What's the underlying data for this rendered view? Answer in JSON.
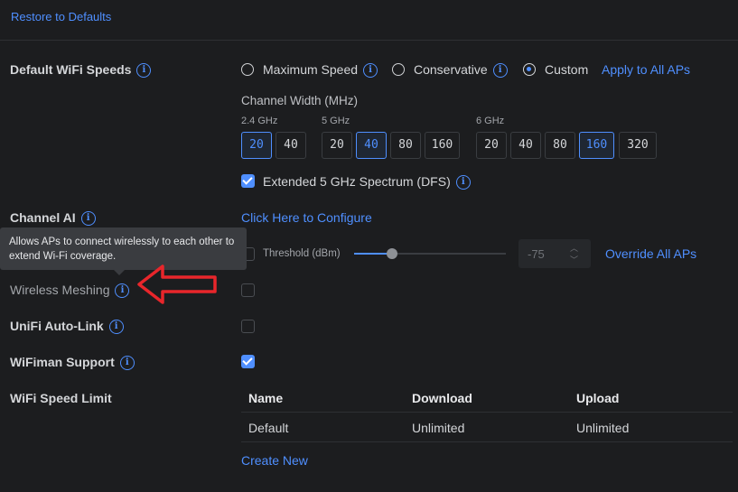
{
  "restore_label": "Restore to Defaults",
  "wifi_speeds": {
    "label": "Default WiFi Speeds",
    "options": [
      "Maximum Speed",
      "Conservative",
      "Custom"
    ],
    "selected": "Custom",
    "apply_label": "Apply to All APs",
    "channel_width_label": "Channel Width (MHz)",
    "bands": [
      {
        "name": "2.4 GHz",
        "widths": [
          "20",
          "40"
        ],
        "selected": "20"
      },
      {
        "name": "5 GHz",
        "widths": [
          "20",
          "40",
          "80",
          "160"
        ],
        "selected": "40"
      },
      {
        "name": "6 GHz",
        "widths": [
          "20",
          "40",
          "80",
          "160",
          "320"
        ],
        "selected": "160"
      }
    ],
    "dfs_label": "Extended 5 GHz Spectrum (DFS)",
    "dfs_checked": true
  },
  "channel_ai": {
    "label": "Channel AI",
    "configure_label": "Click Here to Configure"
  },
  "threshold": {
    "label": "Threshold (dBm)",
    "value": "-75",
    "override_label": "Override All APs"
  },
  "tooltip": {
    "text": "Allows APs to connect wirelessly to each other to extend Wi-Fi coverage."
  },
  "wireless_meshing": {
    "label": "Wireless Meshing",
    "checked": false
  },
  "auto_link": {
    "label": "UniFi Auto-Link",
    "checked": false
  },
  "wifiman": {
    "label": "WiFiman Support",
    "checked": true
  },
  "speed_limit": {
    "label": "WiFi Speed Limit",
    "columns": [
      "Name",
      "Download",
      "Upload"
    ],
    "rows": [
      [
        "Default",
        "Unlimited",
        "Unlimited"
      ]
    ],
    "create_label": "Create New"
  },
  "colors": {
    "accent": "#4f8fff",
    "annotation_arrow": "#e8262b",
    "background": "#1c1d1f"
  }
}
